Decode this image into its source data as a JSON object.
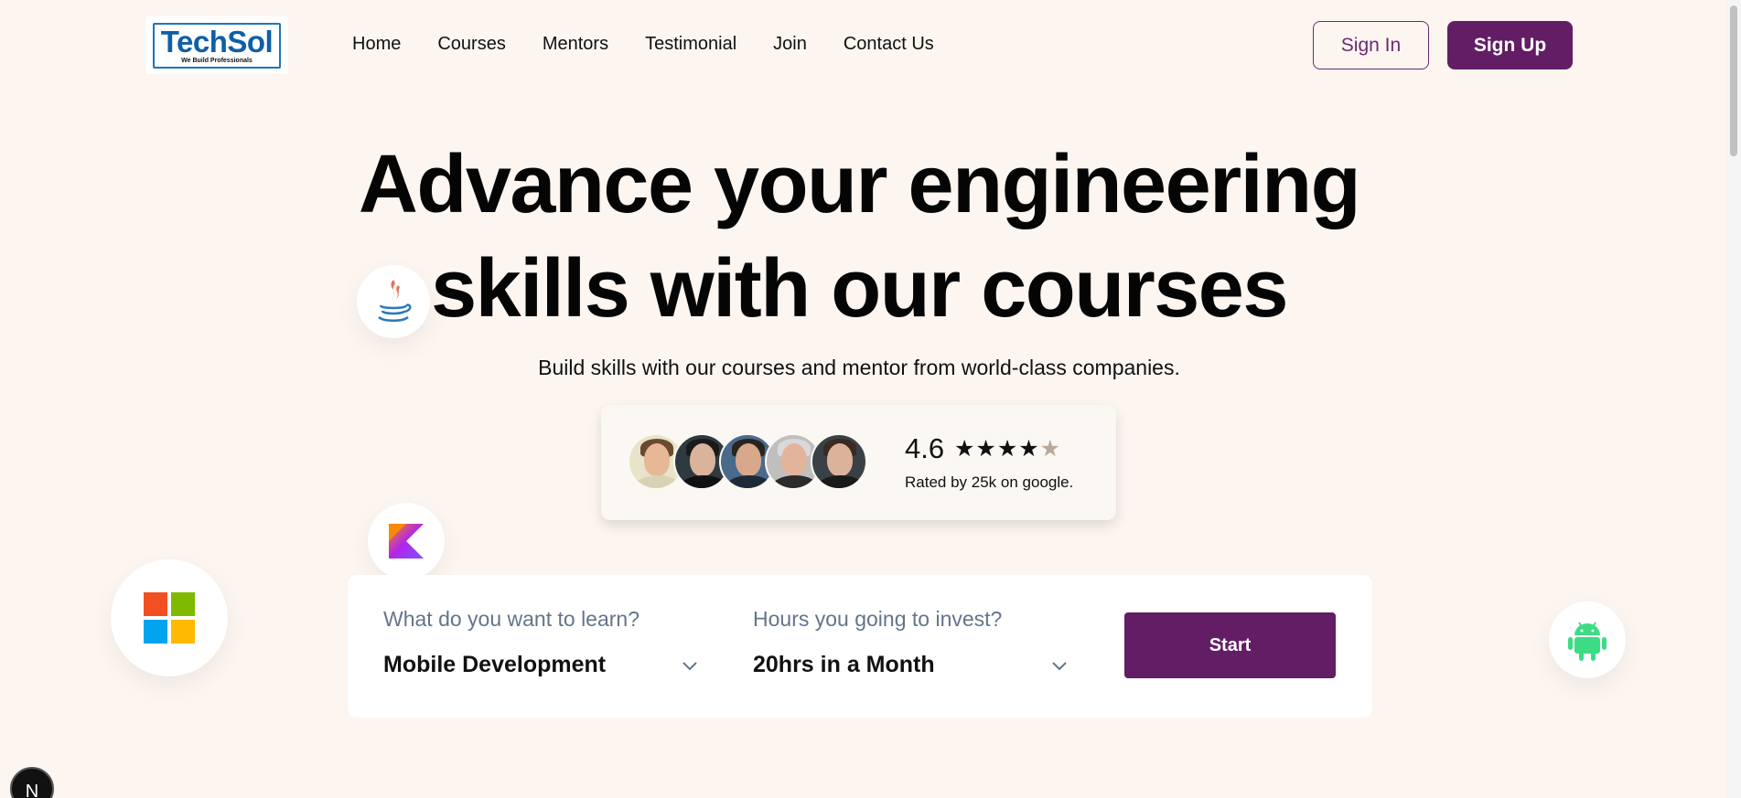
{
  "header": {
    "logo": {
      "text": "TechSol",
      "tagline": "We Build Professionals"
    },
    "nav": [
      "Home",
      "Courses",
      "Mentors",
      "Testimonial",
      "Join",
      "Contact Us"
    ],
    "sign_in_label": "Sign In",
    "sign_up_label": "Sign Up"
  },
  "hero": {
    "title_line1": "Advance your engineering",
    "title_line2": "skills with our courses",
    "subtitle": "Build skills with our courses and mentor from world-class companies."
  },
  "rating": {
    "value": "4.6",
    "stars": 4.6,
    "stars_text": "★★★★",
    "stars_half": "★",
    "note": "Rated by 25k on google."
  },
  "floating_icons": [
    "java-icon",
    "kotlin-icon",
    "microsoft-icon",
    "android-icon"
  ],
  "search_panel": {
    "learn_label": "What do you want to learn?",
    "learn_value": "Mobile Development",
    "hours_label": "Hours you going to invest?",
    "hours_value": "20hrs in a Month",
    "start_label": "Start"
  },
  "corner_badge": "N",
  "colors": {
    "background": "#fcf5f0",
    "brand": "#621d64",
    "logo_blue": "#0d5fa8"
  }
}
